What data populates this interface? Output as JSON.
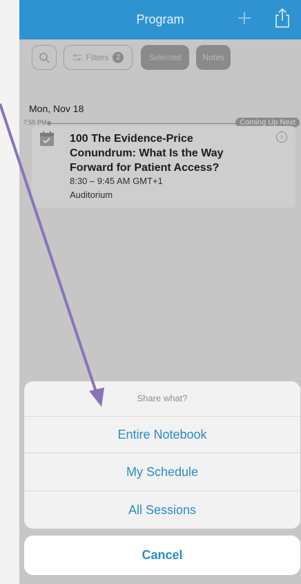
{
  "header": {
    "title": "Program"
  },
  "toolbar": {
    "filters_label": "Filters",
    "filters_count": "2",
    "selected_label": "Selected",
    "notes_label": "Notes"
  },
  "schedule": {
    "date": "Mon, Nov 18",
    "now_time": "7:55 PM",
    "coming_up": "Coming Up Next",
    "session": {
      "title": "100 The Evidence-Price Conundrum: What Is the Way Forward for Patient Access?",
      "time": "8:30 – 9:45 AM GMT+1",
      "room": "Auditorium"
    }
  },
  "share_sheet": {
    "title": "Share what?",
    "options": [
      "Entire Notebook",
      "My Schedule",
      "All Sessions"
    ],
    "cancel": "Cancel"
  },
  "colors": {
    "header": "#2f93d1",
    "action_text": "#2a8cc8",
    "arrow": "#8b73b3"
  }
}
